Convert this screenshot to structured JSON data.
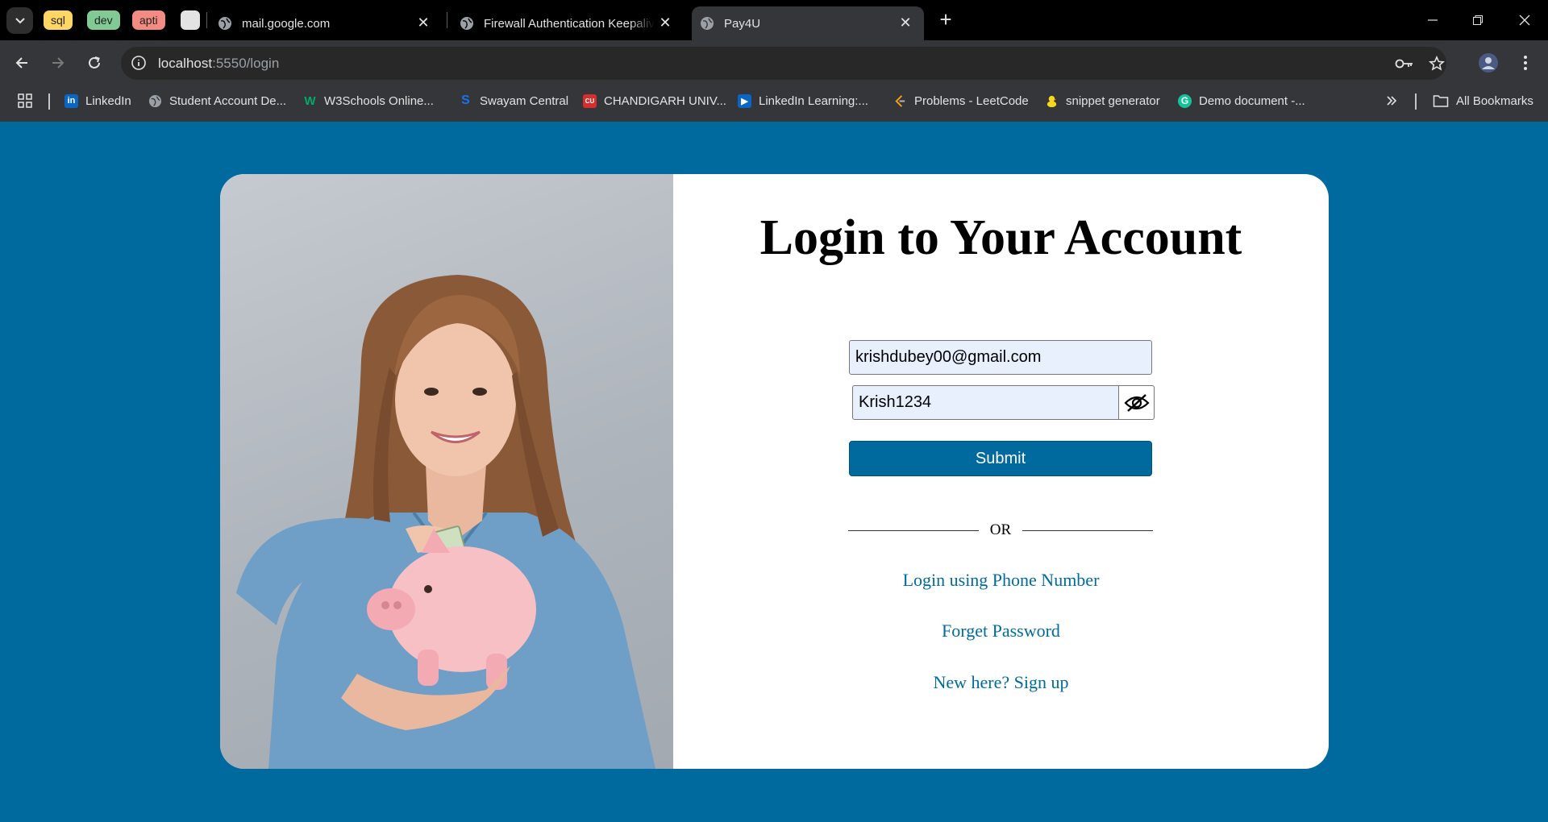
{
  "browser": {
    "tab_groups": [
      "sql",
      "dev",
      "apti"
    ],
    "tabs": [
      {
        "label": "mail.google.com"
      },
      {
        "label": "Firewall Authentication Keepalive"
      },
      {
        "label": "Pay4U",
        "active": true
      }
    ],
    "url_host": "localhost",
    "url_rest": ":5550/login",
    "bookmarks": [
      {
        "label": "LinkedIn",
        "icon": "linkedin-icon",
        "color": "#0a66c2"
      },
      {
        "label": "Student Account De...",
        "icon": "globe-icon"
      },
      {
        "label": "W3Schools Online...",
        "icon": "w3schools-icon",
        "color": "#04aa6d"
      },
      {
        "label": "Swayam Central",
        "icon": "swayam-icon",
        "color": "#1a73e8"
      },
      {
        "label": "CHANDIGARH UNIV...",
        "icon": "cu-icon",
        "color": "#d32f2f"
      },
      {
        "label": "LinkedIn Learning:...",
        "icon": "linkedin-learning-icon",
        "color": "#0a66c2"
      },
      {
        "label": "Problems - LeetCode",
        "icon": "leetcode-icon",
        "color": "#ffa116"
      },
      {
        "label": "snippet generator",
        "icon": "duck-icon",
        "color": "#f9d71c"
      },
      {
        "label": "Demo document -...",
        "icon": "grammarly-icon",
        "color": "#15c39a"
      }
    ],
    "all_bookmarks": "All Bookmarks"
  },
  "page": {
    "title": "Login to Your Account",
    "email_value": "krishdubey00@gmail.com",
    "password_value": "Krish1234",
    "submit_label": "Submit",
    "or_label": "OR",
    "phone_login_link": "Login using Phone Number",
    "forget_password_link": "Forget Password",
    "new_here_text": "New here?",
    "signup_link": "Sign up",
    "accent_color": "#006a9e"
  }
}
